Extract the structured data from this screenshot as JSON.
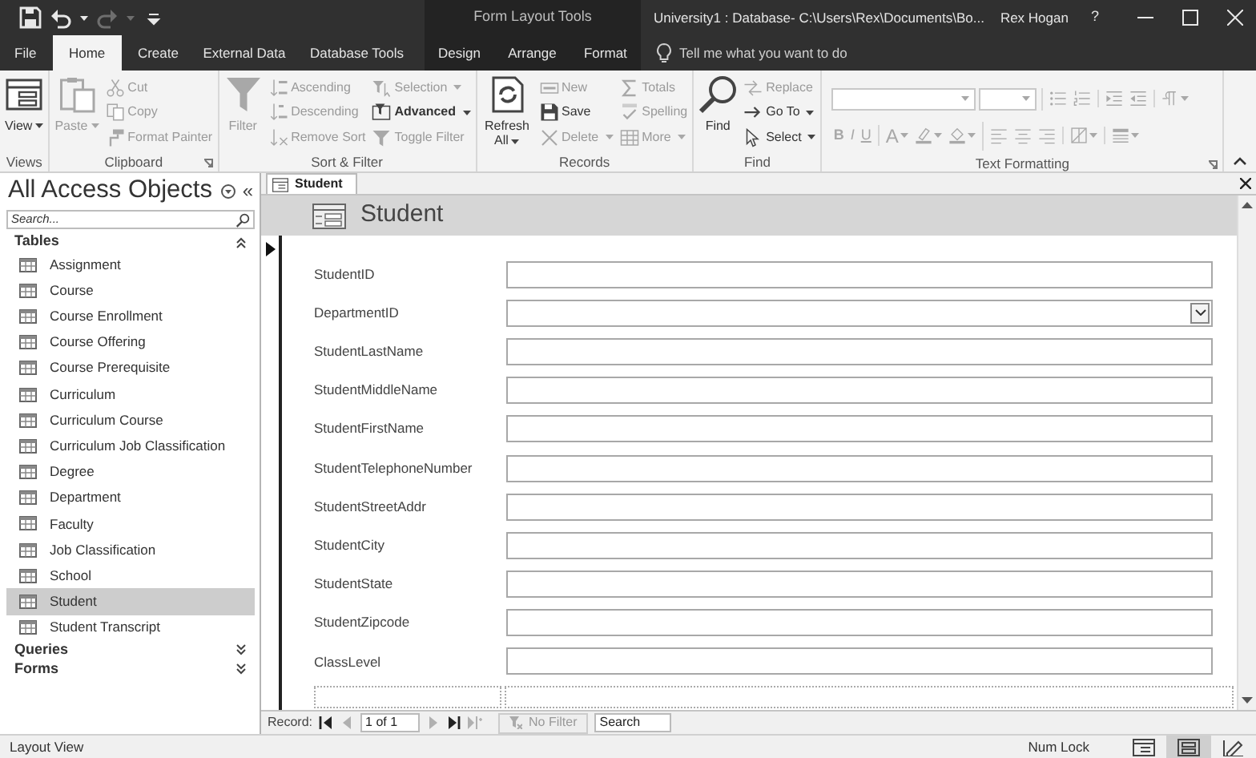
{
  "title_bar": {
    "quick_access": [
      {
        "kind": "save",
        "disabled": false,
        "dropdown": false
      },
      {
        "kind": "undo",
        "disabled": false,
        "dropdown": true
      },
      {
        "kind": "redo",
        "disabled": true,
        "dropdown": true
      },
      {
        "kind": "customize",
        "disabled": false,
        "dropdown": false
      }
    ],
    "contextual_label": "Form Layout Tools",
    "title": "University1 : Database- C:\\Users\\Rex\\Documents\\Bo...",
    "user": "Rex Hogan",
    "help": "?"
  },
  "ribbon_tabs": [
    {
      "label": "File",
      "selected": false,
      "contextual": false
    },
    {
      "label": "Home",
      "selected": true,
      "contextual": false
    },
    {
      "label": "Create",
      "selected": false,
      "contextual": false
    },
    {
      "label": "External Data",
      "selected": false,
      "contextual": false
    },
    {
      "label": "Database Tools",
      "selected": false,
      "contextual": false
    },
    {
      "label": "Design",
      "selected": false,
      "contextual": true
    },
    {
      "label": "Arrange",
      "selected": false,
      "contextual": true
    },
    {
      "label": "Format",
      "selected": false,
      "contextual": true
    }
  ],
  "tell_me": {
    "placeholder": "Tell me what you want to do"
  },
  "ribbon_groups": [
    {
      "label": "Views",
      "kind": "commands",
      "launcher": false,
      "columns": [
        [
          {
            "label": "View",
            "kind": "view",
            "large": true,
            "disabled": false,
            "dropdown": true
          }
        ]
      ]
    },
    {
      "label": "Clipboard",
      "kind": "commands",
      "launcher": true,
      "columns": [
        [
          {
            "label": "Paste",
            "kind": "paste",
            "large": true,
            "disabled": true,
            "dropdown": true
          }
        ],
        [
          {
            "label": "Cut",
            "kind": "cut",
            "large": false,
            "disabled": true,
            "dropdown": false
          },
          {
            "label": "Copy",
            "kind": "copy",
            "large": false,
            "disabled": true,
            "dropdown": false
          },
          {
            "label": "Format Painter",
            "kind": "painter",
            "large": false,
            "disabled": true,
            "dropdown": false
          }
        ]
      ]
    },
    {
      "label": "Sort & Filter",
      "kind": "commands",
      "launcher": false,
      "columns": [
        [
          {
            "label": "Filter",
            "kind": "filter",
            "large": true,
            "disabled": true,
            "dropdown": false
          }
        ],
        [
          {
            "label": "Ascending",
            "kind": "ascending",
            "large": false,
            "disabled": true,
            "dropdown": false
          },
          {
            "label": "Descending",
            "kind": "descending",
            "large": false,
            "disabled": true,
            "dropdown": false
          },
          {
            "label": "Remove Sort",
            "kind": "unsort",
            "large": false,
            "disabled": true,
            "dropdown": false
          }
        ],
        [
          {
            "label": "Selection",
            "kind": "selection",
            "large": false,
            "disabled": true,
            "dropdown": true
          },
          {
            "label": "Advanced",
            "kind": "advanced",
            "large": false,
            "disabled": false,
            "dropdown": true
          },
          {
            "label": "Toggle Filter",
            "kind": "toggle",
            "large": false,
            "disabled": true,
            "dropdown": false
          }
        ]
      ]
    },
    {
      "label": "Records",
      "kind": "commands",
      "launcher": false,
      "columns": [
        [
          {
            "label": "Refresh All",
            "kind": "refresh",
            "large": true,
            "disabled": false,
            "dropdown": true
          }
        ],
        [
          {
            "label": "New",
            "kind": "new",
            "large": false,
            "disabled": true,
            "dropdown": false
          },
          {
            "label": "Save",
            "kind": "save",
            "large": false,
            "disabled": false,
            "dropdown": false
          },
          {
            "label": "Delete",
            "kind": "delete",
            "large": false,
            "disabled": true,
            "dropdown": true
          }
        ],
        [
          {
            "label": "Totals",
            "kind": "totals",
            "large": false,
            "disabled": true,
            "dropdown": false
          },
          {
            "label": "Spelling",
            "kind": "spelling",
            "large": false,
            "disabled": true,
            "dropdown": false
          },
          {
            "label": "More",
            "kind": "more",
            "large": false,
            "disabled": true,
            "dropdown": true
          }
        ]
      ]
    },
    {
      "label": "Find",
      "kind": "commands",
      "launcher": false,
      "columns": [
        [
          {
            "label": "Find",
            "kind": "find",
            "large": true,
            "disabled": false,
            "dropdown": false
          }
        ],
        [
          {
            "label": "Replace",
            "kind": "replace",
            "large": false,
            "disabled": true,
            "dropdown": false
          },
          {
            "label": "Go To",
            "kind": "goto",
            "large": false,
            "disabled": false,
            "dropdown": true
          },
          {
            "label": "Select",
            "kind": "select",
            "large": false,
            "disabled": false,
            "dropdown": true
          }
        ]
      ]
    },
    {
      "label": "Text Formatting",
      "kind": "formatting",
      "launcher": true,
      "disabled": true,
      "rows": [
        [
          [
            {
              "kind": "font-box"
            },
            {
              "kind": "size-box"
            }
          ],
          [
            {
              "kind": "bullets"
            },
            {
              "kind": "numbering"
            }
          ],
          [
            {
              "kind": "indent"
            },
            {
              "kind": "outdent"
            }
          ],
          [
            {
              "kind": "paragraph",
              "dropdown": true
            }
          ]
        ],
        [
          [
            {
              "kind": "bold",
              "label": "B"
            },
            {
              "kind": "italic",
              "label": "I"
            },
            {
              "kind": "underline",
              "label": "U"
            }
          ],
          [
            {
              "kind": "font-color",
              "label": "A",
              "dropdown": true
            },
            {
              "kind": "highlight",
              "dropdown": true
            },
            {
              "kind": "fill",
              "dropdown": true
            }
          ],
          [
            {
              "kind": "align-left"
            },
            {
              "kind": "align-center"
            },
            {
              "kind": "align-right"
            }
          ],
          [
            {
              "kind": "gridlines",
              "dropdown": true
            }
          ],
          [
            {
              "kind": "row-color",
              "dropdown": true
            }
          ]
        ]
      ]
    }
  ],
  "navigation_pane": {
    "title": "All Access Objects",
    "collapse": "«",
    "search": {
      "placeholder": "Search..."
    },
    "sections": [
      {
        "label": "Tables",
        "expanded": true,
        "items": [
          {
            "label": "Assignment",
            "selected": false
          },
          {
            "label": "Course",
            "selected": false
          },
          {
            "label": "Course Enrollment",
            "selected": false
          },
          {
            "label": "Course Offering",
            "selected": false
          },
          {
            "label": "Course Prerequisite",
            "selected": false
          },
          {
            "label": "Curriculum",
            "selected": false
          },
          {
            "label": "Curriculum Course",
            "selected": false
          },
          {
            "label": "Curriculum Job Classification",
            "selected": false
          },
          {
            "label": "Degree",
            "selected": false
          },
          {
            "label": "Department",
            "selected": false
          },
          {
            "label": "Faculty",
            "selected": false
          },
          {
            "label": "Job Classification",
            "selected": false
          },
          {
            "label": "School",
            "selected": false
          },
          {
            "label": "Student",
            "selected": true
          },
          {
            "label": "Student Transcript",
            "selected": false
          }
        ]
      },
      {
        "label": "Queries",
        "expanded": false
      },
      {
        "label": "Forms",
        "expanded": false
      }
    ]
  },
  "document": {
    "tabs": [
      {
        "label": "Student",
        "selected": true
      }
    ],
    "form": {
      "title": "Student",
      "fields": [
        {
          "label": "StudentID",
          "kind": "text"
        },
        {
          "label": "DepartmentID",
          "kind": "combo"
        },
        {
          "label": "StudentLastName",
          "kind": "text"
        },
        {
          "label": "StudentMiddleName",
          "kind": "text"
        },
        {
          "label": "StudentFirstName",
          "kind": "text"
        },
        {
          "label": "StudentTelephoneNumber",
          "kind": "text"
        },
        {
          "label": "StudentStreetAddr",
          "kind": "text"
        },
        {
          "label": "StudentCity",
          "kind": "text"
        },
        {
          "label": "StudentState",
          "kind": "text"
        },
        {
          "label": "StudentZipcode",
          "kind": "text"
        },
        {
          "label": "ClassLevel",
          "kind": "text"
        }
      ]
    },
    "record_nav": {
      "label": "Record:",
      "buttons": [
        {
          "kind": "first",
          "disabled": false
        },
        {
          "kind": "prev",
          "disabled": true
        },
        {
          "kind": "next",
          "disabled": true
        },
        {
          "kind": "last",
          "disabled": false
        },
        {
          "kind": "new",
          "disabled": true
        }
      ],
      "position": "1 of 1",
      "filter": "No Filter",
      "search": {
        "placeholder": "Search"
      }
    }
  },
  "status_bar": {
    "text": "Layout View",
    "indicator": "Num Lock",
    "views": [
      {
        "kind": "form",
        "selected": false
      },
      {
        "kind": "layout",
        "selected": true
      },
      {
        "kind": "design",
        "selected": false
      }
    ]
  }
}
